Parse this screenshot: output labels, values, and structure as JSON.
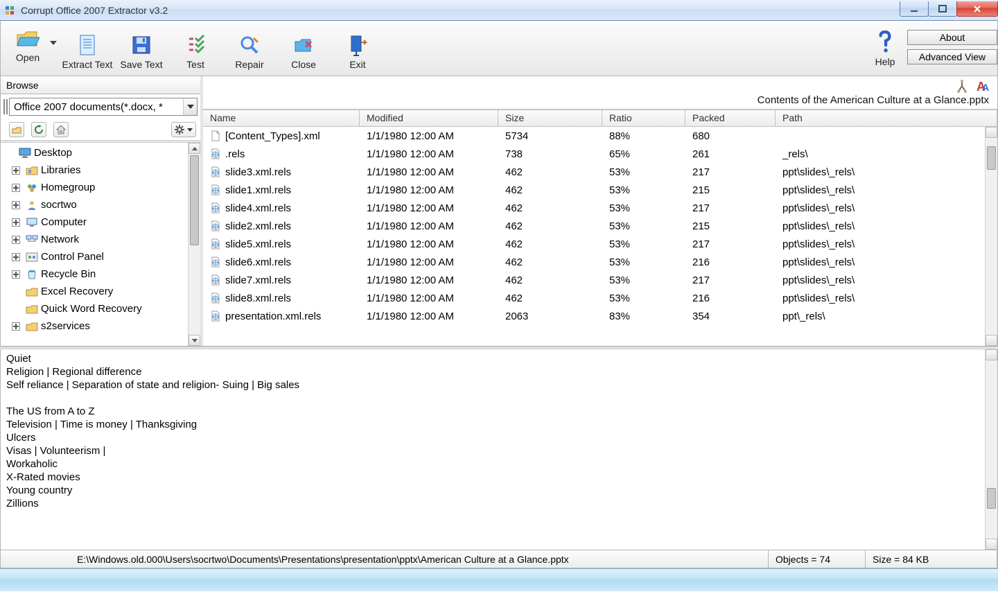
{
  "window": {
    "title": "Corrupt Office 2007 Extractor v3.2"
  },
  "toolbar": {
    "open": "Open",
    "extract_text": "Extract Text",
    "save_text": "Save Text",
    "test": "Test",
    "repair": "Repair",
    "close": "Close",
    "exit": "Exit",
    "help": "Help",
    "about_btn": "About",
    "advanced_btn": "Advanced View"
  },
  "browse": {
    "header": "Browse",
    "filter": "Office 2007 documents(*.docx, *",
    "tree": [
      {
        "label": "Desktop",
        "icon": "monitor",
        "expandable": false,
        "level": 0
      },
      {
        "label": "Libraries",
        "icon": "folder-lib",
        "expandable": true,
        "level": 1
      },
      {
        "label": "Homegroup",
        "icon": "homegroup",
        "expandable": true,
        "level": 1
      },
      {
        "label": "socrtwo",
        "icon": "user",
        "expandable": true,
        "level": 1
      },
      {
        "label": "Computer",
        "icon": "computer",
        "expandable": true,
        "level": 1
      },
      {
        "label": "Network",
        "icon": "network",
        "expandable": true,
        "level": 1
      },
      {
        "label": "Control Panel",
        "icon": "control-panel",
        "expandable": true,
        "level": 1
      },
      {
        "label": "Recycle Bin",
        "icon": "recycle-bin",
        "expandable": true,
        "level": 1
      },
      {
        "label": "Excel Recovery",
        "icon": "folder",
        "expandable": false,
        "level": 1
      },
      {
        "label": "Quick Word Recovery",
        "icon": "folder",
        "expandable": false,
        "level": 1
      },
      {
        "label": "s2services",
        "icon": "folder",
        "expandable": true,
        "level": 1
      }
    ]
  },
  "content": {
    "title": "Contents of the American Culture at a Glance.pptx",
    "columns": {
      "name": "Name",
      "modified": "Modified",
      "size": "Size",
      "ratio": "Ratio",
      "packed": "Packed",
      "path": "Path"
    },
    "rows": [
      {
        "name": "[Content_Types].xml",
        "modified": "1/1/1980  12:00 AM",
        "size": "5734",
        "ratio": "88%",
        "packed": "680",
        "path": "",
        "icon": "file-generic"
      },
      {
        "name": ".rels",
        "modified": "1/1/1980  12:00 AM",
        "size": "738",
        "ratio": "65%",
        "packed": "261",
        "path": "_rels\\",
        "icon": "file-xml"
      },
      {
        "name": "slide3.xml.rels",
        "modified": "1/1/1980  12:00 AM",
        "size": "462",
        "ratio": "53%",
        "packed": "217",
        "path": "ppt\\slides\\_rels\\",
        "icon": "file-xml"
      },
      {
        "name": "slide1.xml.rels",
        "modified": "1/1/1980  12:00 AM",
        "size": "462",
        "ratio": "53%",
        "packed": "215",
        "path": "ppt\\slides\\_rels\\",
        "icon": "file-xml"
      },
      {
        "name": "slide4.xml.rels",
        "modified": "1/1/1980  12:00 AM",
        "size": "462",
        "ratio": "53%",
        "packed": "217",
        "path": "ppt\\slides\\_rels\\",
        "icon": "file-xml"
      },
      {
        "name": "slide2.xml.rels",
        "modified": "1/1/1980  12:00 AM",
        "size": "462",
        "ratio": "53%",
        "packed": "215",
        "path": "ppt\\slides\\_rels\\",
        "icon": "file-xml"
      },
      {
        "name": "slide5.xml.rels",
        "modified": "1/1/1980  12:00 AM",
        "size": "462",
        "ratio": "53%",
        "packed": "217",
        "path": "ppt\\slides\\_rels\\",
        "icon": "file-xml"
      },
      {
        "name": "slide6.xml.rels",
        "modified": "1/1/1980  12:00 AM",
        "size": "462",
        "ratio": "53%",
        "packed": "216",
        "path": "ppt\\slides\\_rels\\",
        "icon": "file-xml"
      },
      {
        "name": "slide7.xml.rels",
        "modified": "1/1/1980  12:00 AM",
        "size": "462",
        "ratio": "53%",
        "packed": "217",
        "path": "ppt\\slides\\_rels\\",
        "icon": "file-xml"
      },
      {
        "name": "slide8.xml.rels",
        "modified": "1/1/1980  12:00 AM",
        "size": "462",
        "ratio": "53%",
        "packed": "216",
        "path": "ppt\\slides\\_rels\\",
        "icon": "file-xml"
      },
      {
        "name": "presentation.xml.rels",
        "modified": "1/1/1980  12:00 AM",
        "size": "2063",
        "ratio": "83%",
        "packed": "354",
        "path": "ppt\\_rels\\",
        "icon": "file-xml"
      }
    ]
  },
  "extract_text": "Quiet\nReligion | Regional difference\nSelf reliance | Separation of state and religion- Suing | Big sales\n\nThe US from A to Z\nTelevision | Time is money | Thanksgiving\nUlcers\nVisas | Volunteerism |\nWorkaholic\nX-Rated movies\nYoung country\nZillions",
  "status": {
    "path": "E:\\Windows.old.000\\Users\\socrtwo\\Documents\\Presentations\\presentation\\pptx\\American Culture at a Glance.pptx",
    "objects": "Objects = 74",
    "size": "Size = 84 KB"
  }
}
